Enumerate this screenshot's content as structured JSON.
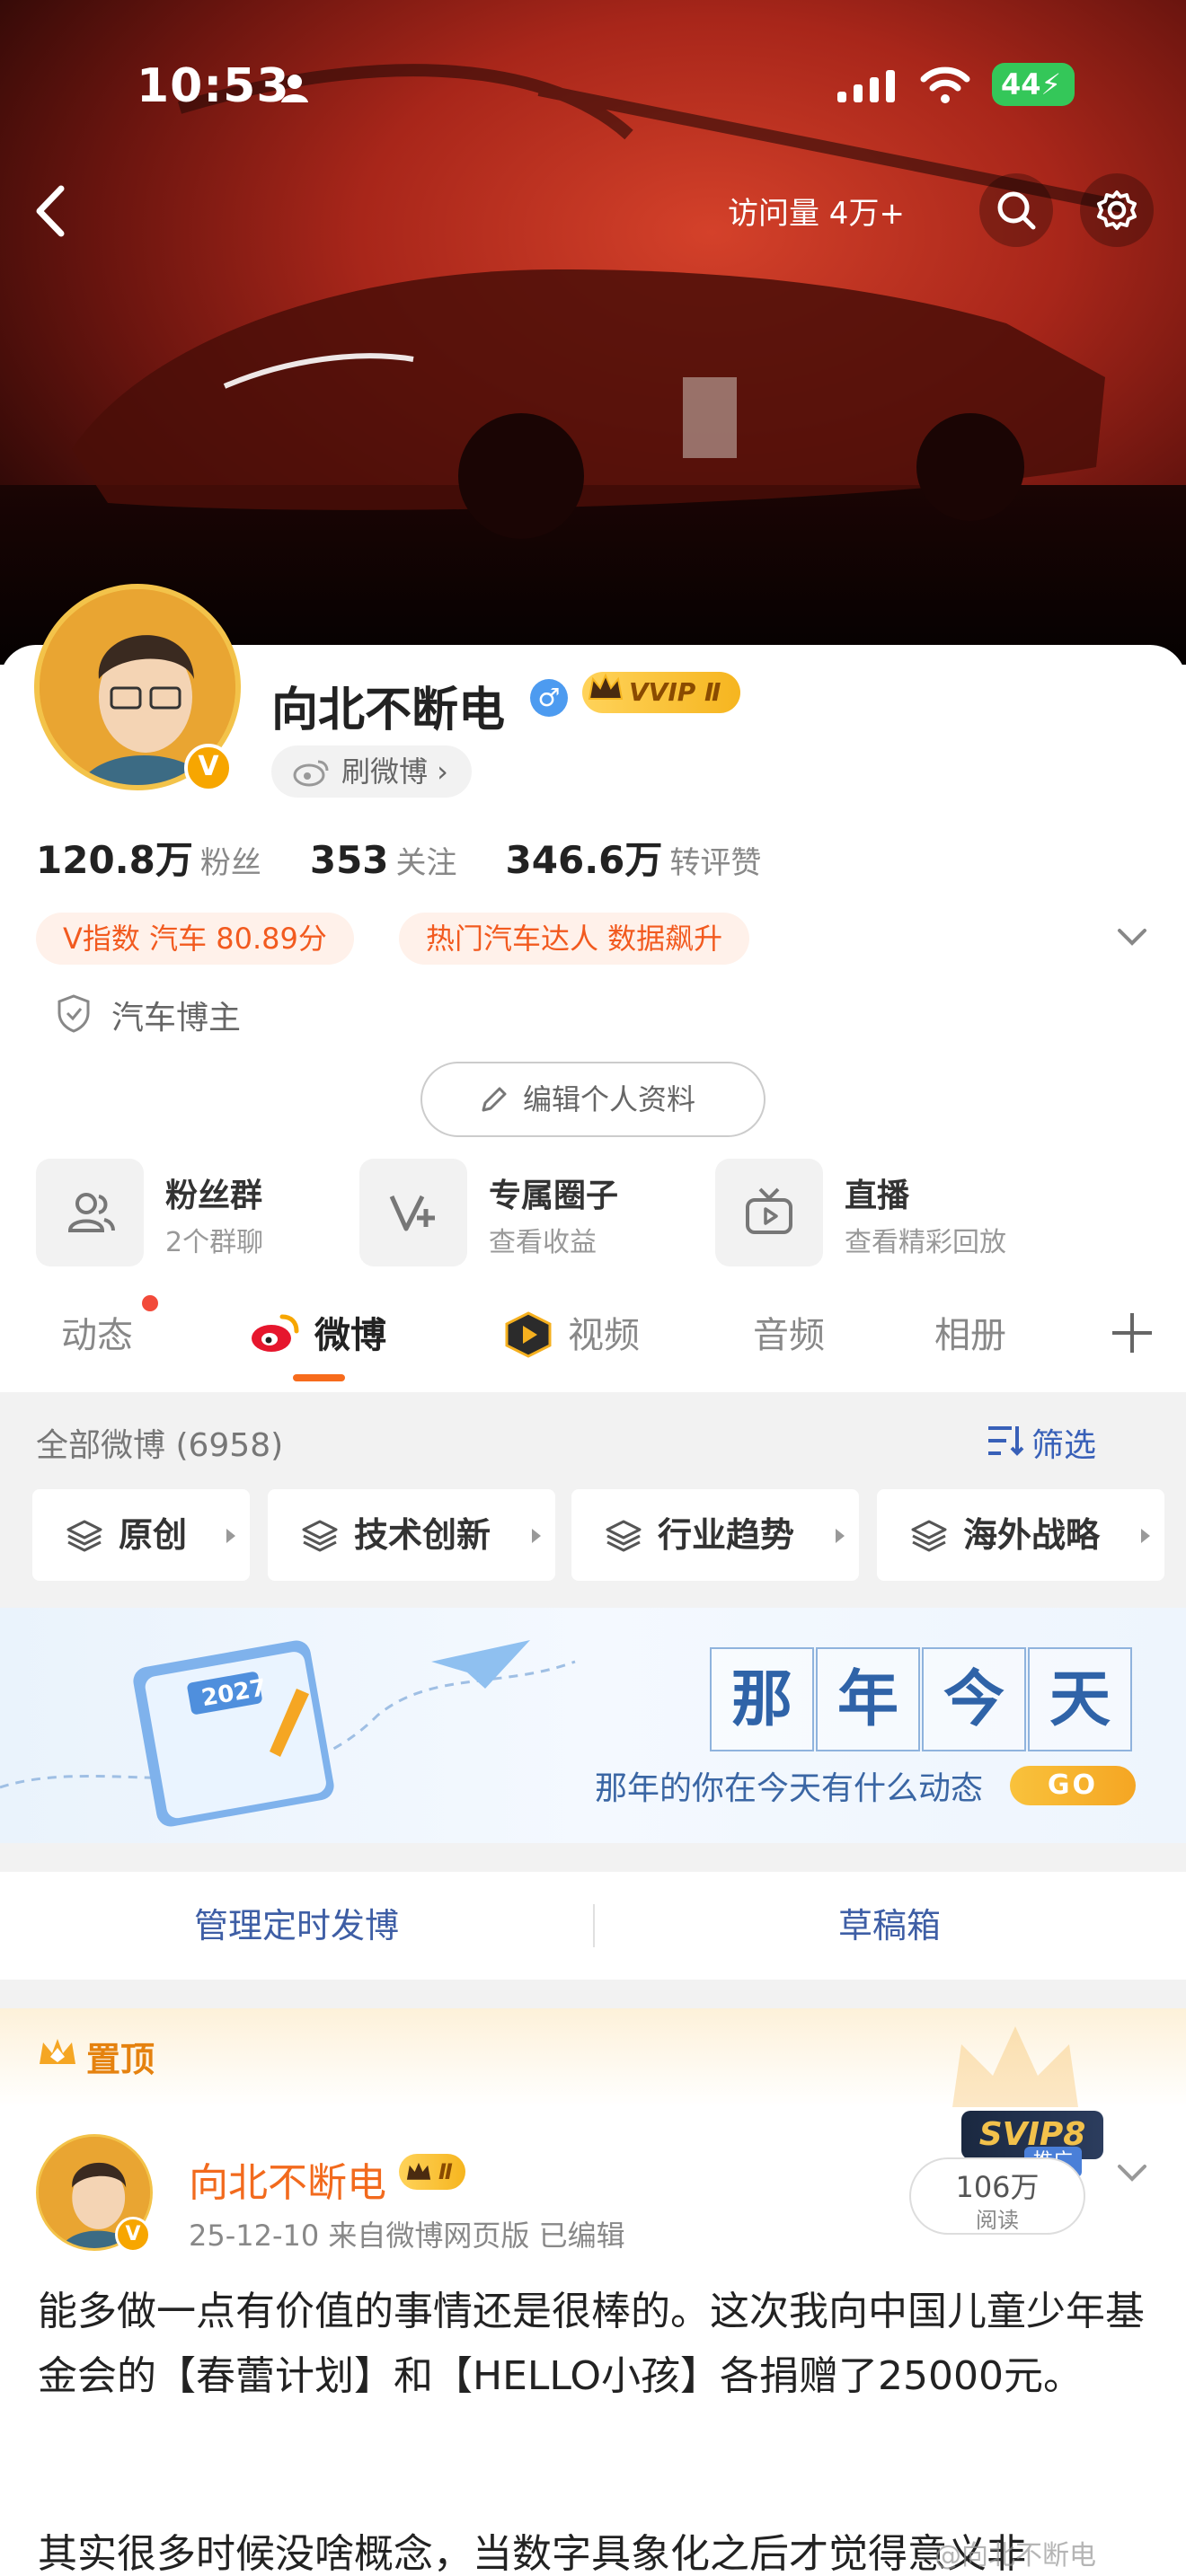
{
  "status_bar": {
    "time": "10:53",
    "battery": "44"
  },
  "header": {
    "visits": "访问量 4万+"
  },
  "profile": {
    "name": "向北不断电",
    "vip_label": "VVIP Ⅱ",
    "brush_label": "刷微博 ›",
    "stats": [
      {
        "num": "120.8万",
        "label": "粉丝"
      },
      {
        "num": "353",
        "label": "关注"
      },
      {
        "num": "346.6万",
        "label": "转评赞"
      }
    ],
    "tags": [
      "V指数 汽车 80.89分",
      "热门汽车达人 数据飙升"
    ],
    "category": "汽车博主",
    "edit_button": "编辑个人资料"
  },
  "quick_links": [
    {
      "title": "粉丝群",
      "sub": "2个群聊",
      "icon": "group-icon"
    },
    {
      "title": "专属圈子",
      "sub": "查看收益",
      "icon": "v-plus-icon"
    },
    {
      "title": "直播",
      "sub": "查看精彩回放",
      "icon": "tv-icon"
    }
  ],
  "tabs": [
    "动态",
    "微博",
    "视频",
    "音频",
    "相册"
  ],
  "feed": {
    "all_label": "全部微博 (6958)",
    "filter_label": "筛选",
    "chips": [
      "原创",
      "技术创新",
      "行业趋势",
      "海外战略"
    ]
  },
  "memory_banner": {
    "chars": [
      "那",
      "年",
      "今",
      "天"
    ],
    "subtitle": "那年的你在今天有什么动态",
    "go": "GO",
    "calendar_year": "2027"
  },
  "manage": {
    "scheduled": "管理定时发博",
    "drafts": "草稿箱"
  },
  "post": {
    "pinned_label": "置顶",
    "author": "向北不断电",
    "badge": "Ⅱ",
    "meta": "25-12-10  来自微博网页版  已编辑",
    "svip": "SVIP8",
    "promo": "推广",
    "reads_num": "106万",
    "reads_label": "阅读",
    "text": "能多做一点有价值的事情还是很棒的。这次我向中国儿童少年基金会的【春蕾计划】和【HELLO小孩】各捐赠了25000元。",
    "text2": "其实很多时候没啥概念，当数字具象化之后才觉得意义非"
  },
  "watermark": "@向北不断电"
}
